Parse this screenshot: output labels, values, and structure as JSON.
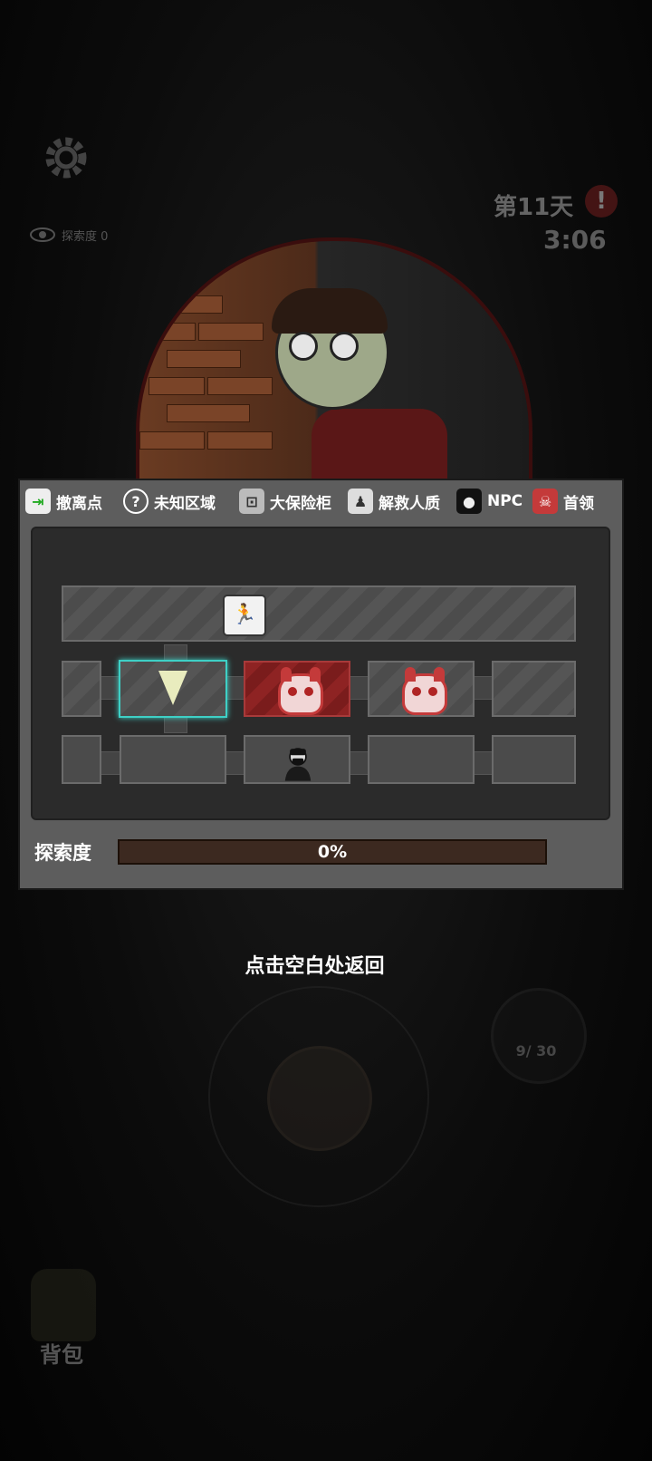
{
  "hud": {
    "explore_small_label": "探索度",
    "explore_small_value": "0",
    "day_label": "第11天",
    "alert_symbol": "!",
    "timer": "3:06"
  },
  "legend": [
    {
      "label": "撤离点",
      "icon": "exit-icon"
    },
    {
      "label": "未知区域",
      "icon": "question-icon"
    },
    {
      "label": "大保险柜",
      "icon": "safe-icon"
    },
    {
      "label": "解救人质",
      "icon": "hostage-icon"
    },
    {
      "label": "NPC",
      "icon": "npc-icon"
    },
    {
      "label": "首领",
      "icon": "boss-skull-icon"
    }
  ],
  "map": {
    "rooms": [
      {
        "row": 0,
        "col": 0,
        "type": "exit",
        "icon": "exit-icon"
      },
      {
        "row": 1,
        "col": 0,
        "type": "normal"
      },
      {
        "row": 1,
        "col": 1,
        "type": "current",
        "icon": "player-marker-icon"
      },
      {
        "row": 1,
        "col": 2,
        "type": "boss",
        "icon": "boss-skull-icon"
      },
      {
        "row": 1,
        "col": 3,
        "type": "boss",
        "icon": "boss-skull-icon"
      },
      {
        "row": 1,
        "col": 4,
        "type": "normal"
      },
      {
        "row": 2,
        "col": 0,
        "type": "plain"
      },
      {
        "row": 2,
        "col": 1,
        "type": "plain"
      },
      {
        "row": 2,
        "col": 2,
        "type": "npc",
        "icon": "npc-icon"
      },
      {
        "row": 2,
        "col": 3,
        "type": "plain"
      },
      {
        "row": 2,
        "col": 4,
        "type": "plain"
      }
    ]
  },
  "exploration": {
    "label": "探索度",
    "progress_text": "0%",
    "progress": 0
  },
  "hint": "点击空白处返回",
  "ammo": "9/ 30",
  "backpack_label": "背包",
  "colors": {
    "boss": "#8e2323",
    "current_border": "#3ed0c6",
    "progress_bg": "#3c2920"
  }
}
